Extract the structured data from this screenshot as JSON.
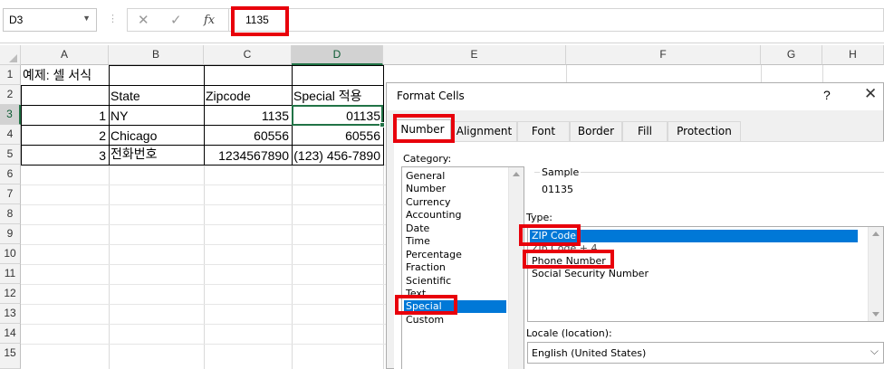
{
  "formula_bar": {
    "name_box": "D3",
    "formula": "1135"
  },
  "sheet": {
    "columns": [
      "A",
      "B",
      "C",
      "D",
      "E",
      "F",
      "G",
      "H"
    ],
    "rows": [
      "1",
      "2",
      "3",
      "4",
      "5",
      "6",
      "7",
      "8",
      "9",
      "10",
      "11",
      "12",
      "13",
      "14",
      "15"
    ],
    "selected_column": "D",
    "selected_row": "3",
    "cells": {
      "a1": "예제: 셀 서식",
      "b2": "State",
      "c2": "Zipcode",
      "d2": "Special 적용",
      "a3": "1",
      "b3": "NY",
      "c3": "1135",
      "d3": "01135",
      "a4": "2",
      "b4": "Chicago",
      "c4": "60556",
      "d4": "60556",
      "a5": "3",
      "b5": "전화번호",
      "c5": "1234567890",
      "d5": "(123) 456-7890"
    }
  },
  "dialog": {
    "title": "Format Cells",
    "help": "?",
    "close": "✕",
    "tabs": [
      "Number",
      "Alignment",
      "Font",
      "Border",
      "Fill",
      "Protection"
    ],
    "active_tab": "Number",
    "category_label": "Category:",
    "categories": [
      "General",
      "Number",
      "Currency",
      "Accounting",
      "Date",
      "Time",
      "Percentage",
      "Fraction",
      "Scientific",
      "Text",
      "Special",
      "Custom"
    ],
    "selected_category": "Special",
    "sample_label": "Sample",
    "sample_value": "01135",
    "type_label": "Type:",
    "types": [
      "ZIP Code",
      "Zip Code + 4",
      "Phone Number",
      "Social Security Number"
    ],
    "selected_type": "ZIP Code",
    "locale_label": "Locale (location):",
    "locale_value": "English (United States)"
  },
  "colors": {
    "accent": "#217346",
    "highlight": "#e8000b",
    "selection": "#0078d7"
  }
}
